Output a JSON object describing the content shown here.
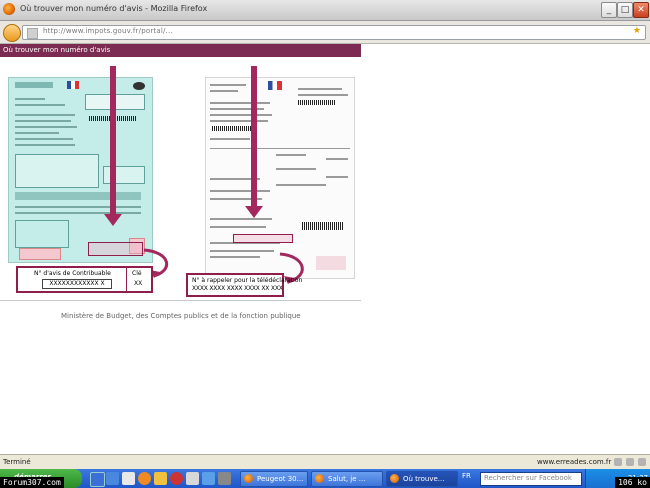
{
  "window": {
    "title": "Où trouver mon numéro d'avis - Mozilla Firefox"
  },
  "window_buttons": {
    "minimize": "_",
    "maximize": "□",
    "close": "✕"
  },
  "address": {
    "url": "http://www.impots.gouv.fr/portal/..."
  },
  "page": {
    "banner": "Où trouver mon numéro d'avis",
    "callout_left": {
      "label": "N° d'avis de Contribuable",
      "number": "XXXXXXXXXXXX X",
      "key_label": "Clé",
      "key_value": "XX"
    },
    "callout_right": {
      "line1": "N° à rappeler pour la télédéclaration",
      "line2": "XXXX XXXX XXXX XXXX XX XXX"
    },
    "caption": "Ministère de Budget, des Comptes publics et de la fonction publique"
  },
  "status": {
    "text": "Terminé",
    "domain": "www.erreades.com.fr"
  },
  "taskbar": {
    "start": "démarrer",
    "tasks": [
      {
        "label": "Peugeot 30..."
      },
      {
        "label": "Salut, je ..."
      },
      {
        "label": "Où trouve..."
      }
    ],
    "language": "FR",
    "search_placeholder": "Rechercher sur Facebook",
    "time": "21:37"
  },
  "watermark": {
    "left": "Forum307.com",
    "right": "106 ko"
  },
  "colors": {
    "banner": "#7c2c52",
    "arrow": "#a3285e",
    "taskbar": "#2a5fd0",
    "start": "#3aa335"
  }
}
